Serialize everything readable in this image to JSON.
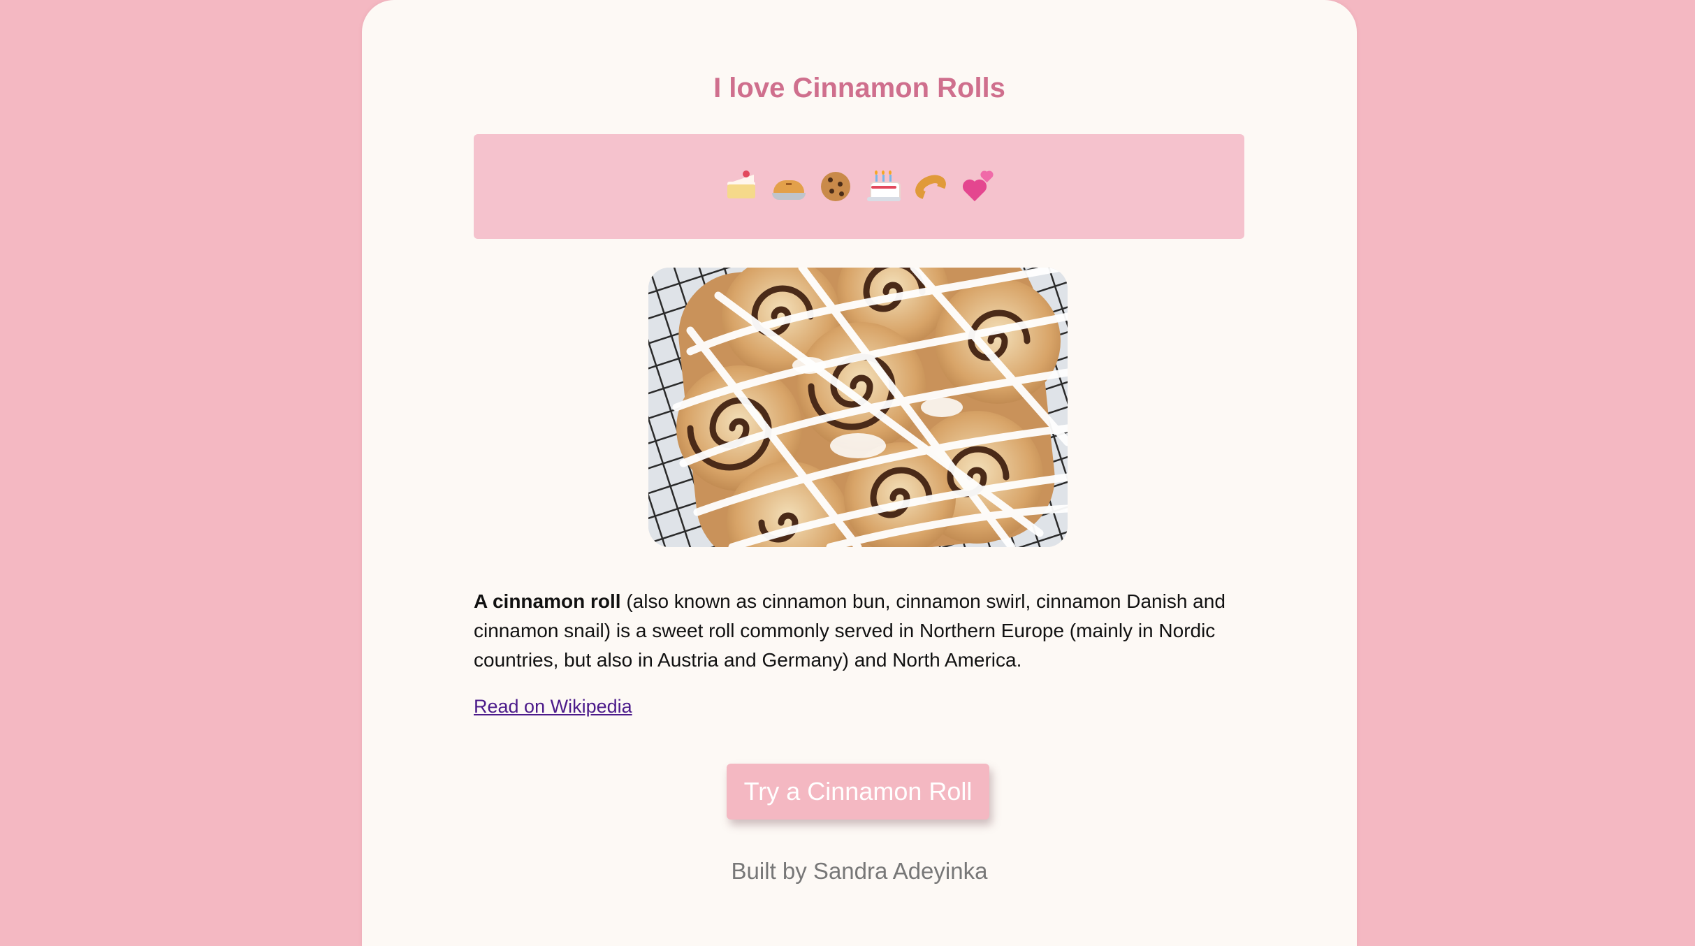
{
  "page": {
    "title": "I love Cinnamon Rolls"
  },
  "banner": {
    "emojis": [
      {
        "icon": "cake-slice-icon",
        "glyph": "🍰"
      },
      {
        "icon": "pie-icon",
        "glyph": "🥧"
      },
      {
        "icon": "cookie-icon",
        "glyph": "🍪"
      },
      {
        "icon": "birthday-cake-icon",
        "glyph": "🎂"
      },
      {
        "icon": "croissant-icon",
        "glyph": "🥐"
      },
      {
        "icon": "two-hearts-icon",
        "glyph": "💕"
      }
    ]
  },
  "image": {
    "subject": "cinnamon rolls with white icing on a cooling rack"
  },
  "description": {
    "bold": "A cinnamon roll",
    "rest": " (also known as cinnamon bun, cinnamon swirl, cinnamon Danish and cinnamon snail) is a sweet roll commonly served in Northern Europe (mainly in Nordic countries, but also in Austria and Germany) and North America."
  },
  "link": {
    "label": "Read on Wikipedia"
  },
  "cta": {
    "label": "Try a Cinnamon Roll"
  },
  "footer": {
    "credit": "Built by Sandra Adeyinka"
  },
  "colors": {
    "background": "#f4b8c2",
    "card": "#fdf9f5",
    "title": "#cf6f8d",
    "banner": "#f5c2cd",
    "button": "#f4b8c2",
    "link": "#4b1a8a"
  }
}
